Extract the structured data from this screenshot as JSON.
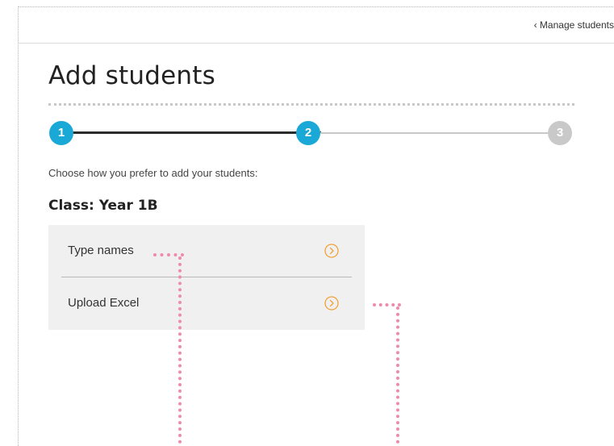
{
  "header": {
    "back_link": "‹ Manage students"
  },
  "page": {
    "title": "Add students",
    "instructions": "Choose how you prefer to add your students:",
    "class_label": "Class: Year 1B"
  },
  "stepper": {
    "steps": [
      {
        "number": "1",
        "state": "complete"
      },
      {
        "number": "2",
        "state": "current"
      },
      {
        "number": "3",
        "state": "upcoming"
      }
    ]
  },
  "options": [
    {
      "label": "Type names",
      "icon": "chevron-right-circle-icon"
    },
    {
      "label": "Upload Excel",
      "icon": "chevron-right-circle-icon"
    }
  ],
  "colors": {
    "accent": "#1aa9d6",
    "step_inactive": "#c9c9c9",
    "progress_done": "#2b2b2b",
    "chevron": "#f0a23a",
    "annotation": "#ef8aab",
    "panel": "#f0f0f0"
  }
}
